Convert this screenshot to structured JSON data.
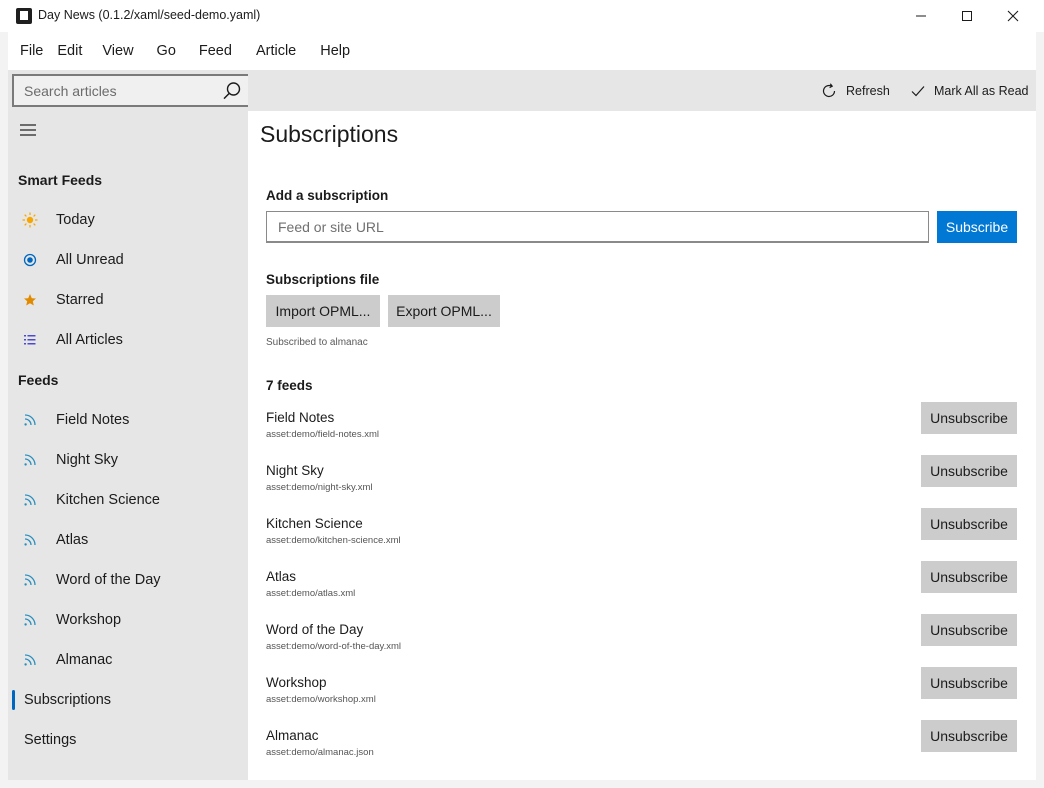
{
  "window": {
    "title": "Day News (0.1.2/xaml/seed-demo.yaml)"
  },
  "menu": [
    "File",
    "Edit",
    "View",
    "Go",
    "Feed",
    "Article",
    "Help"
  ],
  "search": {
    "placeholder": "Search articles"
  },
  "sidebar": {
    "smart_feeds_heading": "Smart Feeds",
    "smart_feeds": [
      {
        "label": "Today",
        "icon": "sun-icon"
      },
      {
        "label": "All Unread",
        "icon": "radio-dot-icon"
      },
      {
        "label": "Starred",
        "icon": "star-icon"
      },
      {
        "label": "All Articles",
        "icon": "list-icon"
      }
    ],
    "feeds_heading": "Feeds",
    "feeds": [
      {
        "label": "Field Notes",
        "icon": "rss-icon"
      },
      {
        "label": "Night Sky",
        "icon": "rss-icon"
      },
      {
        "label": "Kitchen Science",
        "icon": "rss-icon"
      },
      {
        "label": "Atlas",
        "icon": "rss-icon"
      },
      {
        "label": "Word of the Day",
        "icon": "rss-icon"
      },
      {
        "label": "Workshop",
        "icon": "rss-icon"
      },
      {
        "label": "Almanac",
        "icon": "rss-icon"
      }
    ],
    "subscriptions_label": "Subscriptions",
    "settings_label": "Settings",
    "selected": "Subscriptions"
  },
  "toolbar": {
    "refresh_label": "Refresh",
    "mark_all_read_label": "Mark All as Read"
  },
  "main": {
    "title": "Subscriptions",
    "add_heading": "Add a subscription",
    "url_placeholder": "Feed or site URL",
    "subscribe_label": "Subscribe",
    "file_heading": "Subscriptions file",
    "import_label": "Import OPML...",
    "export_label": "Export OPML...",
    "status": "Subscribed to almanac",
    "feeds_count_label": "7 feeds",
    "unsubscribe_label": "Unsubscribe",
    "feeds": [
      {
        "name": "Field Notes",
        "url": "asset:demo/field-notes.xml"
      },
      {
        "name": "Night Sky",
        "url": "asset:demo/night-sky.xml"
      },
      {
        "name": "Kitchen Science",
        "url": "asset:demo/kitchen-science.xml"
      },
      {
        "name": "Atlas",
        "url": "asset:demo/atlas.xml"
      },
      {
        "name": "Word of the Day",
        "url": "asset:demo/word-of-the-day.xml"
      },
      {
        "name": "Workshop",
        "url": "asset:demo/workshop.xml"
      },
      {
        "name": "Almanac",
        "url": "asset:demo/almanac.json"
      }
    ]
  },
  "colors": {
    "accent": "#0078d4",
    "selection_indicator": "#0067c0",
    "sun": "#f7a500",
    "star": "#e08a00",
    "radio": "#0067c0",
    "list": "#4a4ad0",
    "rss": "#2a8fbf"
  }
}
